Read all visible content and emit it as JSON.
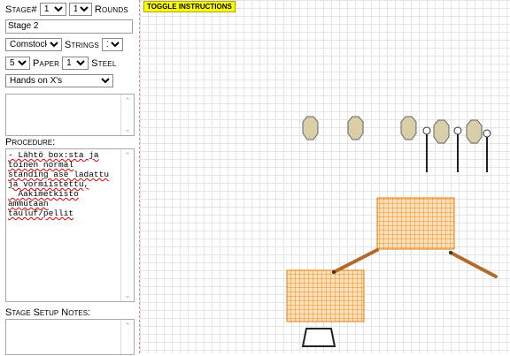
{
  "stage": {
    "label": "Stage#",
    "number": "1",
    "rounds_value": "1",
    "rounds_label": "Rounds"
  },
  "stage_name": "Stage 2",
  "row3": {
    "type": "Comstock",
    "strings_label": "Strings",
    "strings_value": "1"
  },
  "row4": {
    "count": "5",
    "paper_label": "Paper",
    "paper_value": "1",
    "steel_label": "Steel"
  },
  "start_position": "Hands on X's",
  "procedure": {
    "label": "Procedure:",
    "lines": [
      "- Lähtö box:sta ja",
      "toinen normal",
      "standing ase ladattu",
      "ja vormiistettu,",
      "  Aakimetkisto",
      "ammutaan",
      "tauluf/pellit"
    ]
  },
  "setup_notes_label": "Stage Setup Notes:",
  "toggle_label": "TOGGLE INSTRUCTIONS",
  "colors": {
    "target_orange": "#f0a04a",
    "steel_fill": "#d8cfa8",
    "wall_brown": "#b4692a"
  }
}
